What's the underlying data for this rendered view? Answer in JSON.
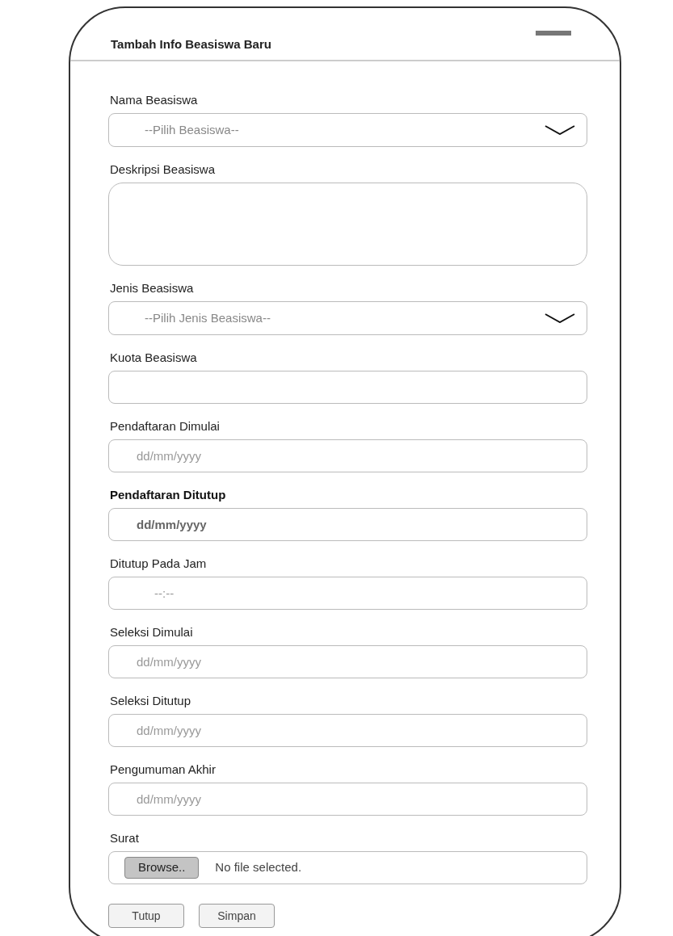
{
  "dialog": {
    "title": "Tambah Info Beasiswa Baru"
  },
  "fields": [
    {
      "kind": "select",
      "label": "Nama Beasiswa",
      "bold": false,
      "placeholder": "--Pilih Beasiswa--"
    },
    {
      "kind": "textarea",
      "label": "Deskripsi Beasiswa",
      "bold": false
    },
    {
      "kind": "select",
      "label": "Jenis Beasiswa",
      "bold": false,
      "placeholder": "--Pilih Jenis Beasiswa--"
    },
    {
      "kind": "text",
      "label": "Kuota Beasiswa",
      "bold": false
    },
    {
      "kind": "text",
      "label": "Pendaftaran Dimulai",
      "bold": false,
      "placeholder": "dd/mm/yyyy"
    },
    {
      "kind": "text",
      "label": "Pendaftaran Ditutup",
      "bold": true,
      "placeholder": "dd/mm/yyyy"
    },
    {
      "kind": "time",
      "label": "Ditutup Pada Jam",
      "bold": false,
      "placeholder": "--:--"
    },
    {
      "kind": "text",
      "label": "Seleksi Dimulai",
      "bold": false,
      "placeholder": "dd/mm/yyyy"
    },
    {
      "kind": "text",
      "label": "Seleksi Ditutup",
      "bold": false,
      "placeholder": "dd/mm/yyyy"
    },
    {
      "kind": "text",
      "label": "Pengumuman Akhir",
      "bold": false,
      "placeholder": "dd/mm/yyyy"
    },
    {
      "kind": "file",
      "label": "Surat",
      "bold": false,
      "button": "Browse..",
      "status": "No file selected."
    }
  ],
  "buttons": [
    "Tutup",
    "Simpan"
  ]
}
